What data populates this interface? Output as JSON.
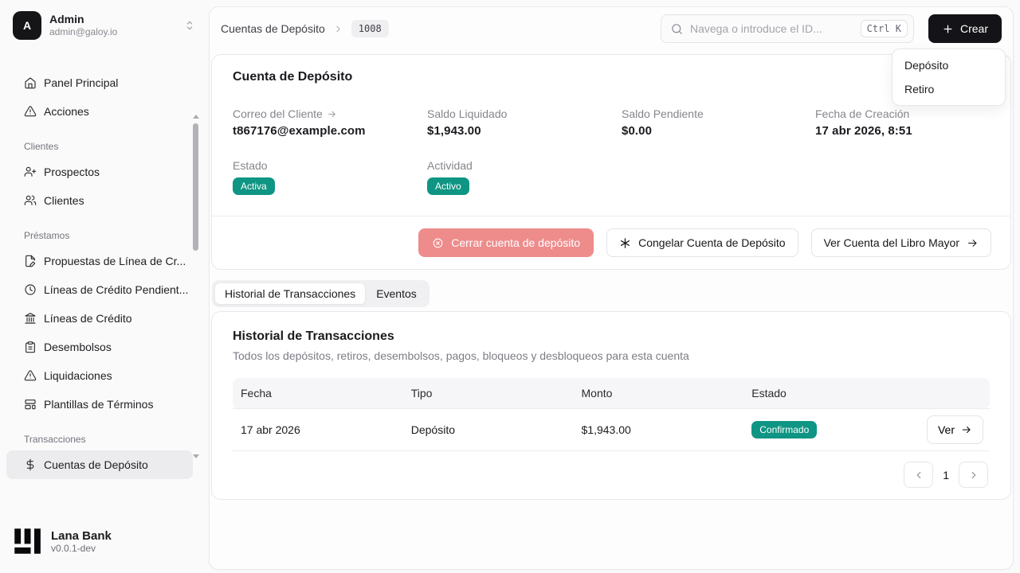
{
  "colors": {
    "accent_teal": "#0f9583",
    "destructive_soft": "#ee8c8c",
    "primary_black": "#141418"
  },
  "sidebar": {
    "user": {
      "initial": "A",
      "name": "Admin",
      "email": "admin@galoy.io"
    },
    "sections": [
      {
        "label": "",
        "items": [
          {
            "icon": "home-icon",
            "label": "Panel Principal"
          },
          {
            "icon": "alert-triangle-icon",
            "label": "Acciones"
          }
        ]
      },
      {
        "label": "Clientes",
        "items": [
          {
            "icon": "user-plus-icon",
            "label": "Prospectos"
          },
          {
            "icon": "users-icon",
            "label": "Clientes"
          }
        ]
      },
      {
        "label": "Préstamos",
        "items": [
          {
            "icon": "file-pen-icon",
            "label": "Propuestas de Línea de Cr..."
          },
          {
            "icon": "clock-icon",
            "label": "Líneas de Crédito Pendient..."
          },
          {
            "icon": "landmark-icon",
            "label": "Líneas de Crédito"
          },
          {
            "icon": "clipboard-icon",
            "label": "Desembolsos"
          },
          {
            "icon": "alert-triangle-icon",
            "label": "Liquidaciones"
          },
          {
            "icon": "layout-template-icon",
            "label": "Plantillas de Términos"
          }
        ]
      },
      {
        "label": "Transacciones",
        "items": [
          {
            "icon": "dollar-icon",
            "label": "Cuentas de Depósito",
            "active": true
          }
        ]
      }
    ],
    "footer": {
      "brand": "Lana Bank",
      "version": "v0.0.1-dev"
    }
  },
  "header": {
    "breadcrumb": {
      "root": "Cuentas de Depósito",
      "badge": "1008"
    },
    "search": {
      "placeholder": "Navega o introduce el ID...",
      "shortcut": "Ctrl K"
    },
    "create_button": "Crear",
    "create_menu": [
      {
        "label": "Depósito"
      },
      {
        "label": "Retiro"
      }
    ]
  },
  "account_card": {
    "title": "Cuenta de Depósito",
    "fields": [
      {
        "label": "Correo del Cliente",
        "value": "t867176@example.com"
      },
      {
        "label": "Saldo Liquidado",
        "value": "$1,943.00"
      },
      {
        "label": "Saldo Pendiente",
        "value": "$0.00"
      },
      {
        "label": "Fecha de Creación",
        "value": "17 abr 2026, 8:51"
      }
    ],
    "status": [
      {
        "label": "Estado",
        "badge": "Activa"
      },
      {
        "label": "Actividad",
        "badge": "Activo"
      }
    ],
    "actions": {
      "close": "Cerrar cuenta de depósito",
      "freeze": "Congelar Cuenta de Depósito",
      "ledger": "Ver Cuenta del Libro Mayor"
    }
  },
  "tabs": [
    {
      "label": "Historial de Transacciones",
      "active": true
    },
    {
      "label": "Eventos",
      "active": false
    }
  ],
  "transactions_card": {
    "title": "Historial de Transacciones",
    "subtitle": "Todos los depósitos, retiros, desembolsos, pagos, bloqueos y desbloqueos para esta cuenta",
    "table": {
      "columns": [
        "Fecha",
        "Tipo",
        "Monto",
        "Estado"
      ],
      "rows": [
        {
          "fecha": "17 abr 2026",
          "tipo": "Depósito",
          "monto": "$1,943.00",
          "estado": "Confirmado",
          "action": "Ver"
        }
      ]
    },
    "pagination": {
      "page": "1"
    }
  }
}
